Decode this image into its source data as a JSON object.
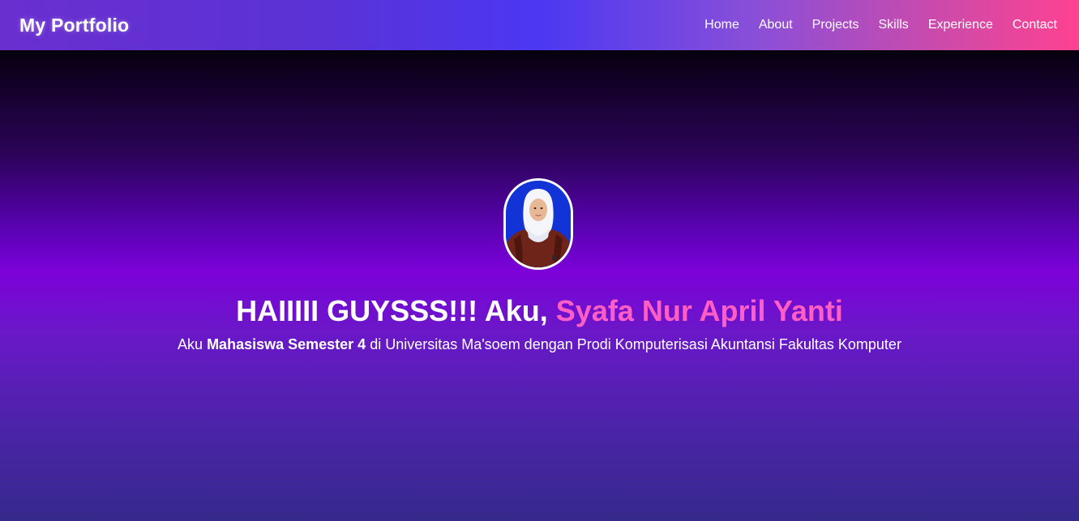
{
  "navbar": {
    "brand": "My Portfolio",
    "links": [
      {
        "label": "Home"
      },
      {
        "label": "About"
      },
      {
        "label": "Projects"
      },
      {
        "label": "Skills"
      },
      {
        "label": "Experience"
      },
      {
        "label": "Contact"
      }
    ]
  },
  "hero": {
    "greeting": "HAIIIII GUYSSS!!! Aku, ",
    "name": "Syafa Nur April Yanti",
    "sub_prefix": "Aku ",
    "sub_bold": "Mahasiswa Semester 4",
    "sub_suffix": " di Universitas Ma'soem dengan Prodi Komputerisasi Akuntansi Fakultas Komputer"
  },
  "colors": {
    "accent_name": "#ff5fc4",
    "navbar_start": "#6a2fcf",
    "navbar_mid": "#4b38f2",
    "navbar_end": "#ff4191"
  }
}
